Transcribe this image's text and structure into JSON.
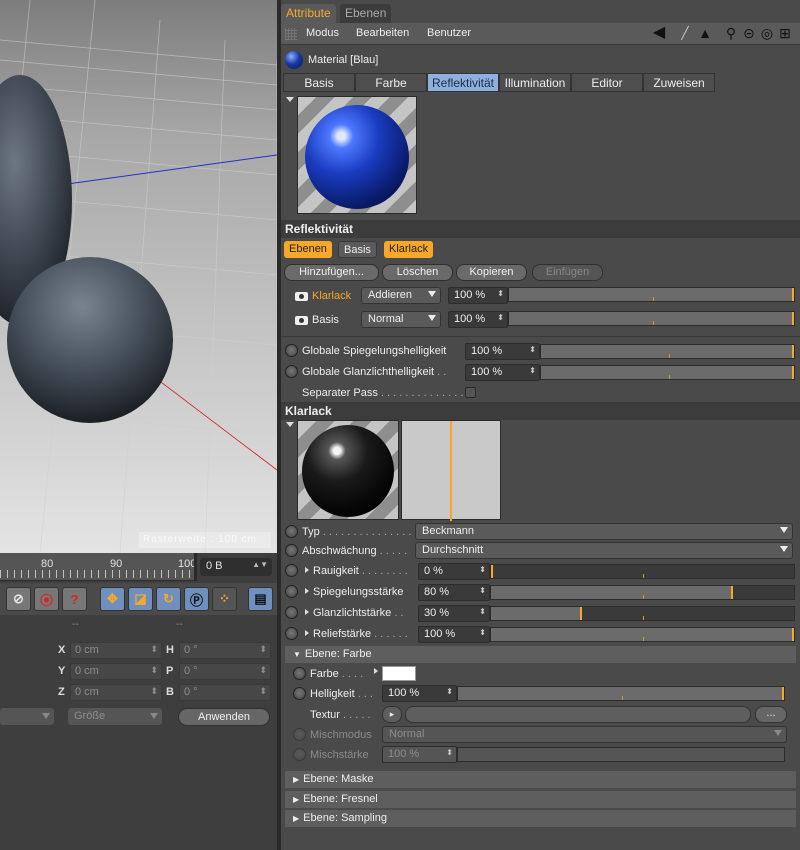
{
  "viewport": {
    "hud_text": "Rasterweite : 100 cm",
    "ruler_labels": [
      "80",
      "90",
      "100"
    ],
    "frame_field": "0 B"
  },
  "coords": {
    "col_dash": "--",
    "rows": [
      {
        "axis_a": "X",
        "val_a": "0 cm",
        "axis_b": "H",
        "val_b": "0 °"
      },
      {
        "axis_a": "Y",
        "val_a": "0 cm",
        "axis_b": "P",
        "val_b": "0 °"
      },
      {
        "axis_a": "Z",
        "val_a": "0 cm",
        "axis_b": "B",
        "val_b": "0 °"
      }
    ],
    "size_dropdown": "Größe",
    "apply_button": "Anwenden"
  },
  "attr": {
    "tabs": [
      "Attribute",
      "Ebenen"
    ],
    "menu": [
      "Modus",
      "Bearbeiten",
      "Benutzer"
    ],
    "material_title": "Material [Blau]",
    "subtabs": [
      "Basis",
      "Farbe",
      "Reflektivität",
      "Illumination",
      "Editor",
      "Zuweisen"
    ],
    "active_subtab": "Reflektivität"
  },
  "reflectivity": {
    "section_title": "Reflektivität",
    "layer_tabs": [
      "Ebenen",
      "Basis",
      "Klarlack"
    ],
    "buttons": [
      "Hinzufügen...",
      "Löschen",
      "Kopieren",
      "Einfügen"
    ],
    "layers": [
      {
        "name": "Klarlack",
        "mode": "Addieren",
        "value": "100 %",
        "active": true,
        "level": 1.0
      },
      {
        "name": "Basis",
        "mode": "Normal",
        "value": "100 %",
        "active": false,
        "level": 1.0
      }
    ],
    "global_spec": {
      "label": "Globale Spiegelungshelligkeit",
      "value": "100 %",
      "level": 1.0
    },
    "global_gloss": {
      "label": "Globale Glanzlichthelligkeit",
      "dots": " . .",
      "value": "100 %",
      "level": 1.0
    },
    "separate_pass": {
      "label": "Separater Pass",
      "dots": " . . . . . . . . . . . . . ."
    }
  },
  "klarlack": {
    "section_title": "Klarlack",
    "typ": {
      "label": "Typ",
      "dots": " . . . . . . . . . . . . . . . .",
      "value": "Beckmann"
    },
    "attenuation": {
      "label": "Abschwächung",
      "dots": " . . . . .",
      "value": "Durchschnitt"
    },
    "sliders": [
      {
        "label": "Rauigkeit",
        "dots": " . . . . . . . .",
        "value": "0 %",
        "level": 0.0
      },
      {
        "label": "Spiegelungsstärke",
        "dots": "",
        "value": "80 %",
        "level": 0.8
      },
      {
        "label": "Glanzlichtstärke",
        "dots": " . .",
        "value": "30 %",
        "level": 0.3
      },
      {
        "label": "Reliefstärke",
        "dots": " . . . . . .",
        "value": "100 %",
        "level": 1.0
      }
    ]
  },
  "ebene_farbe": {
    "title": "Ebene: Farbe",
    "farbe_label": "Farbe",
    "farbe_dots": " . . . .",
    "swatch_color": "#ffffff",
    "helligkeit_label": "Helligkeit",
    "helligkeit_dots": " . . .",
    "helligkeit_value": "100 %",
    "helligkeit_level": 1.0,
    "textur_label": "Textur",
    "textur_dots": " . . . . .",
    "textur_more": "...",
    "mischmodus_label": "Mischmodus",
    "mischmodus_value": "Normal",
    "mischstaerke_label": "Mischstärke",
    "mischstaerke_value": "100 %"
  },
  "collapsed_groups": [
    "Ebene: Maske",
    "Ebene: Fresnel",
    "Ebene: Sampling"
  ],
  "colors": {
    "accent": "#f7a829",
    "active_tab": "#8fb0de",
    "material_blue": "#1b3aa8"
  }
}
